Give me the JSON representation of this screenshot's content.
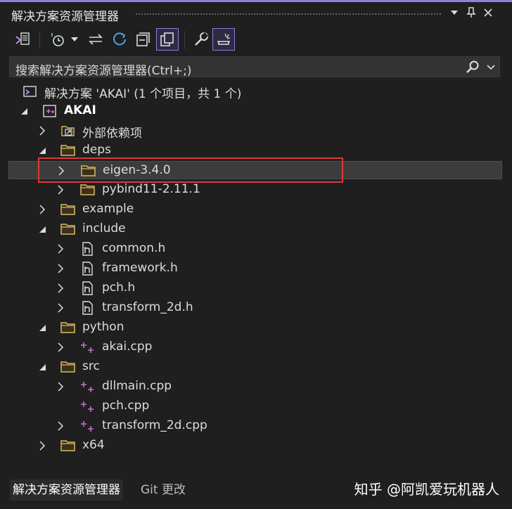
{
  "panel": {
    "title": "解决方案资源管理器",
    "buttons": [
      "chevron-down-icon",
      "pin-icon",
      "close-icon"
    ]
  },
  "toolbar": {
    "tools": [
      "vs-solution-icon",
      "history-icon",
      "dropdown-chevron-icon",
      "sync-arrows-icon",
      "refresh-icon",
      "collapse-all-icon",
      "show-all-files-icon",
      "properties-wrench-icon",
      "preview-icon"
    ]
  },
  "search": {
    "placeholder": "搜索解决方案资源管理器(Ctrl+;)"
  },
  "tree": {
    "items": [
      {
        "label": "解决方案 'AKAI' (1 个项目，共 1 个)",
        "level": 0,
        "icon": "solution-icon",
        "expand": "none"
      },
      {
        "label": "AKAI",
        "level": 1,
        "icon": "cpp-project-icon",
        "expand": "expanded",
        "bold": true
      },
      {
        "label": "外部依赖项",
        "level": 2,
        "icon": "external-deps-icon",
        "expand": "collapsed"
      },
      {
        "label": "deps",
        "level": 2,
        "icon": "folder-icon",
        "expand": "expanded"
      },
      {
        "label": "eigen-3.4.0",
        "level": 3,
        "icon": "folder-icon",
        "expand": "collapsed",
        "selected": true
      },
      {
        "label": "pybind11-2.11.1",
        "level": 3,
        "icon": "folder-icon",
        "expand": "collapsed"
      },
      {
        "label": "example",
        "level": 2,
        "icon": "folder-icon",
        "expand": "collapsed"
      },
      {
        "label": "include",
        "level": 2,
        "icon": "folder-icon",
        "expand": "expanded"
      },
      {
        "label": "common.h",
        "level": 3,
        "icon": "header-file-icon",
        "expand": "collapsed"
      },
      {
        "label": "framework.h",
        "level": 3,
        "icon": "header-file-icon",
        "expand": "collapsed"
      },
      {
        "label": "pch.h",
        "level": 3,
        "icon": "header-file-icon",
        "expand": "collapsed"
      },
      {
        "label": "transform_2d.h",
        "level": 3,
        "icon": "header-file-icon",
        "expand": "collapsed"
      },
      {
        "label": "python",
        "level": 2,
        "icon": "folder-icon",
        "expand": "expanded"
      },
      {
        "label": "akai.cpp",
        "level": 3,
        "icon": "cpp-file-icon",
        "expand": "collapsed"
      },
      {
        "label": "src",
        "level": 2,
        "icon": "folder-icon",
        "expand": "expanded"
      },
      {
        "label": "dllmain.cpp",
        "level": 3,
        "icon": "cpp-file-icon",
        "expand": "collapsed"
      },
      {
        "label": "pch.cpp",
        "level": 3,
        "icon": "cpp-file-icon",
        "expand": "none"
      },
      {
        "label": "transform_2d.cpp",
        "level": 3,
        "icon": "cpp-file-icon",
        "expand": "collapsed"
      },
      {
        "label": "x64",
        "level": 2,
        "icon": "folder-icon",
        "expand": "collapsed"
      }
    ]
  },
  "bottom_tabs": [
    {
      "label": "解决方案资源管理器",
      "active": true
    },
    {
      "label": "Git 更改",
      "active": false
    }
  ],
  "watermark": "知乎 @阿凯爱玩机器人",
  "colors": {
    "background": "#1f1f1f",
    "accent": "#8f7fe0",
    "folder": "#dcb862",
    "cpp": "#c86fd1",
    "highlight_box": "#e0383a"
  }
}
